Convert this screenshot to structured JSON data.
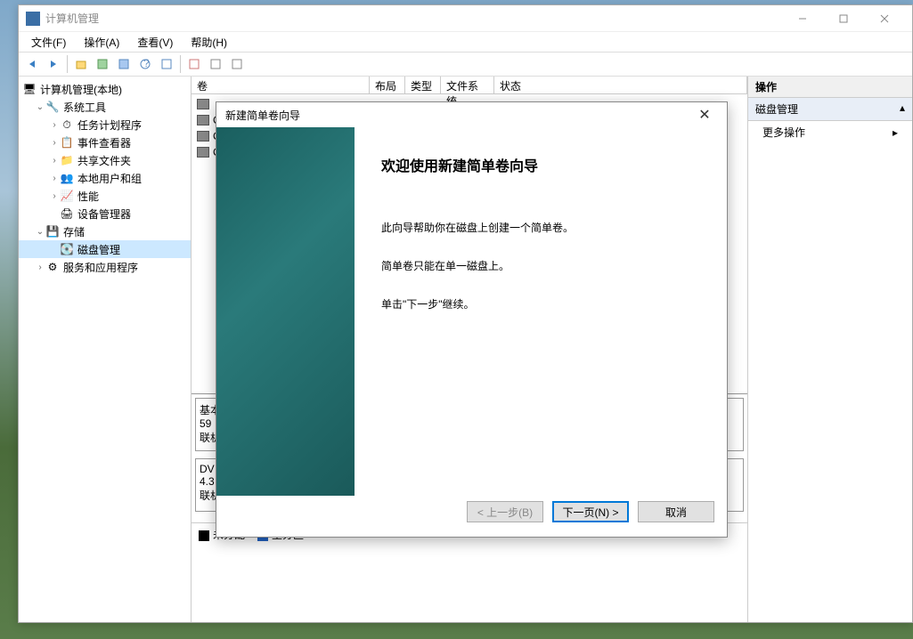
{
  "window": {
    "title": "计算机管理"
  },
  "menu": {
    "file": "文件(F)",
    "action": "操作(A)",
    "view": "查看(V)",
    "help": "帮助(H)"
  },
  "tree": {
    "root": "计算机管理(本地)",
    "system_tools": "系统工具",
    "task_scheduler": "任务计划程序",
    "event_viewer": "事件查看器",
    "shared_folders": "共享文件夹",
    "local_users": "本地用户和组",
    "performance": "性能",
    "device_manager": "设备管理器",
    "storage": "存储",
    "disk_management": "磁盘管理",
    "services_apps": "服务和应用程序"
  },
  "columns": {
    "volume": "卷",
    "layout": "布局",
    "type": "类型",
    "filesystem": "文件系统",
    "status": "状态"
  },
  "volumes": {
    "v1": "C",
    "v2": "C",
    "v3": "C"
  },
  "disk_panel": {
    "disk0_a": "基本",
    "disk0_b": "59",
    "disk0_c": "联机",
    "dvd_a": "DV",
    "dvd_b": "4.3",
    "dvd_c": "联机"
  },
  "legend": {
    "unallocated": "未分配",
    "primary": "主分区"
  },
  "actions": {
    "header": "操作",
    "disk_mgmt": "磁盘管理",
    "more": "更多操作"
  },
  "dialog": {
    "title": "新建简单卷向导",
    "heading": "欢迎使用新建简单卷向导",
    "line1": "此向导帮助你在磁盘上创建一个简单卷。",
    "line2": "简单卷只能在单一磁盘上。",
    "line3": "单击\"下一步\"继续。",
    "back": "< 上一步(B)",
    "next": "下一页(N) >",
    "cancel": "取消"
  }
}
